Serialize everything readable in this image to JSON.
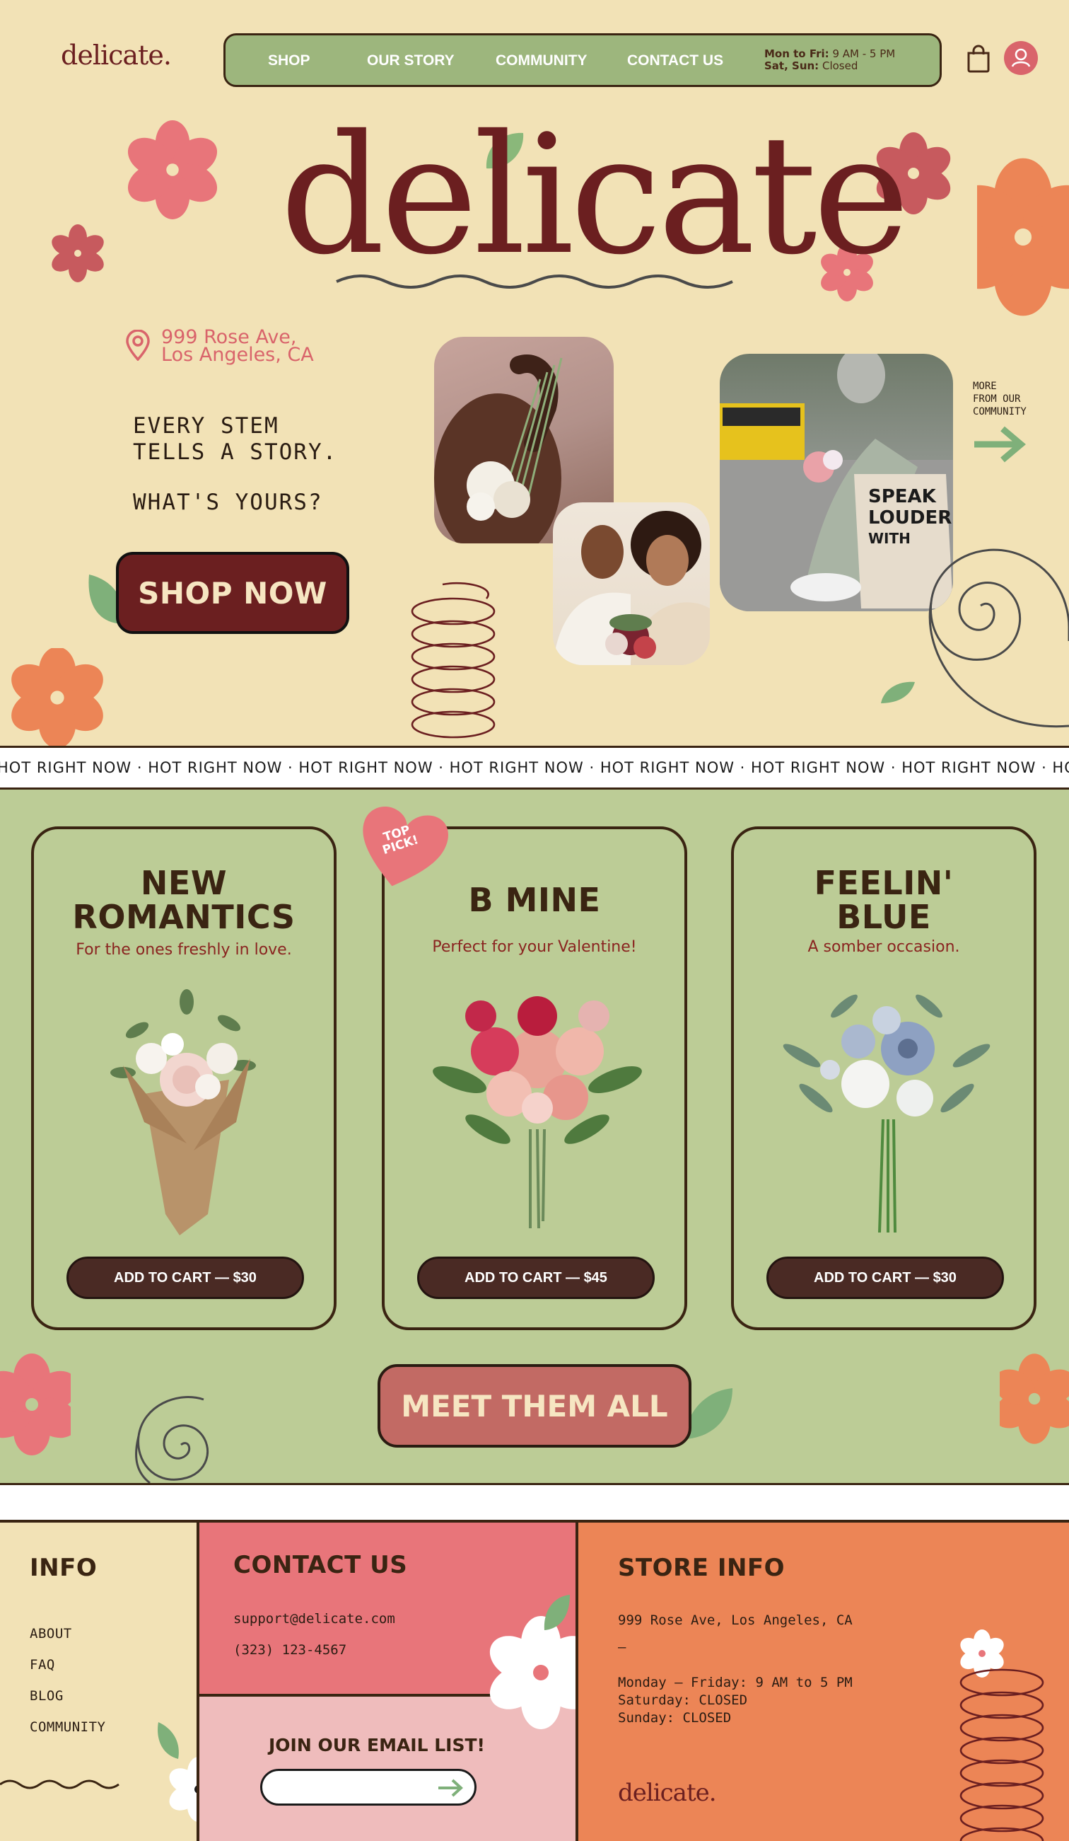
{
  "brand": {
    "logo": "delicate.",
    "hero_title": "delicate"
  },
  "nav": {
    "items": [
      "SHOP",
      "OUR STORY",
      "COMMUNITY",
      "CONTACT US"
    ],
    "hours_weekday_label": "Mon to Fri:",
    "hours_weekday_value": "9 AM - 5 PM",
    "hours_weekend_label": "Sat, Sun:",
    "hours_weekend_value": "Closed",
    "icons": [
      "shopping-bag-icon",
      "user-icon"
    ]
  },
  "hero": {
    "address_line1": "999 Rose Ave,",
    "address_line2": "Los Angeles, CA",
    "tagline_line1": "EVERY STEM",
    "tagline_line2": "TELLS A STORY.",
    "tagline_line3": "WHAT'S YOURS?",
    "shop_button": "SHOP NOW",
    "more_line1": "MORE",
    "more_line2": "FROM OUR",
    "more_line3": "COMMUNITY"
  },
  "marquee": {
    "text": "HOT RIGHT NOW · HOT RIGHT NOW · HOT RIGHT NOW · HOT RIGHT NOW · HOT RIGHT NOW · HOT RIGHT NOW · HOT RIGHT NOW · HOT RIGHT NOW"
  },
  "products": {
    "badge_line1": "TOP",
    "badge_line2": "PICK!",
    "items": [
      {
        "title_line1": "NEW",
        "title_line2": "ROMANTICS",
        "subtitle": "For the ones freshly in love.",
        "button": "ADD TO CART — $30"
      },
      {
        "title_line1": "B MINE",
        "title_line2": "",
        "subtitle": "Perfect for your Valentine!",
        "button": "ADD TO CART — $45"
      },
      {
        "title_line1": "FEELIN'",
        "title_line2": "BLUE",
        "subtitle": "A somber occasion.",
        "button": "ADD TO CART — $30"
      }
    ],
    "meet_button": "MEET THEM ALL"
  },
  "footer": {
    "info_title": "INFO",
    "info_links": [
      "ABOUT",
      "FAQ",
      "BLOG",
      "COMMUNITY"
    ],
    "contact_title": "CONTACT US",
    "contact_email": "support@delicate.com",
    "contact_phone": "(323) 123-4567",
    "join_title": "JOIN OUR EMAIL LIST!",
    "email_placeholder": "",
    "store_title": "STORE INFO",
    "store_address": "999 Rose Ave, Los Angeles, CA",
    "store_dash": "—",
    "store_hours_1": "Monday — Friday: 9 AM to 5 PM",
    "store_hours_2": "Saturday: CLOSED",
    "store_hours_3": "Sunday: CLOSED",
    "store_logo": "delicate."
  },
  "colors": {
    "cream": "#f2e2b6",
    "maroon": "#6b1f20",
    "sage": "#9db67d",
    "light_sage": "#bccc96",
    "pink": "#e8757a",
    "coral": "#ec8556",
    "brown": "#3a2412"
  }
}
